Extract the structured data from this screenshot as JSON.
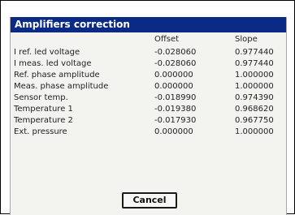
{
  "dialog": {
    "title": "Amplifiers correction",
    "columns": {
      "offset": "Offset",
      "slope": "Slope"
    },
    "rows": [
      {
        "label": "I ref. led voltage",
        "offset": "-0.028060",
        "slope": "0.977440"
      },
      {
        "label": "I meas. led voltage",
        "offset": "-0.028060",
        "slope": "0.977440"
      },
      {
        "label": "Ref. phase amplitude",
        "offset": "0.000000",
        "slope": "1.000000"
      },
      {
        "label": "Meas. phase amplitude",
        "offset": "0.000000",
        "slope": "1.000000"
      },
      {
        "label": "Sensor temp.",
        "offset": "-0.018990",
        "slope": "0.974390"
      },
      {
        "label": "Temperature 1",
        "offset": "-0.019380",
        "slope": "0.968620"
      },
      {
        "label": "Temperature 2",
        "offset": "-0.017930",
        "slope": "0.967750"
      },
      {
        "label": "Ext. pressure",
        "offset": "0.000000",
        "slope": "1.000000"
      }
    ],
    "cancel_label": "Cancel"
  },
  "colors": {
    "title_bar": "#0b2a86",
    "title_text": "#ffffff",
    "dialog_background": "#f3f3ef",
    "text": "#222222"
  }
}
